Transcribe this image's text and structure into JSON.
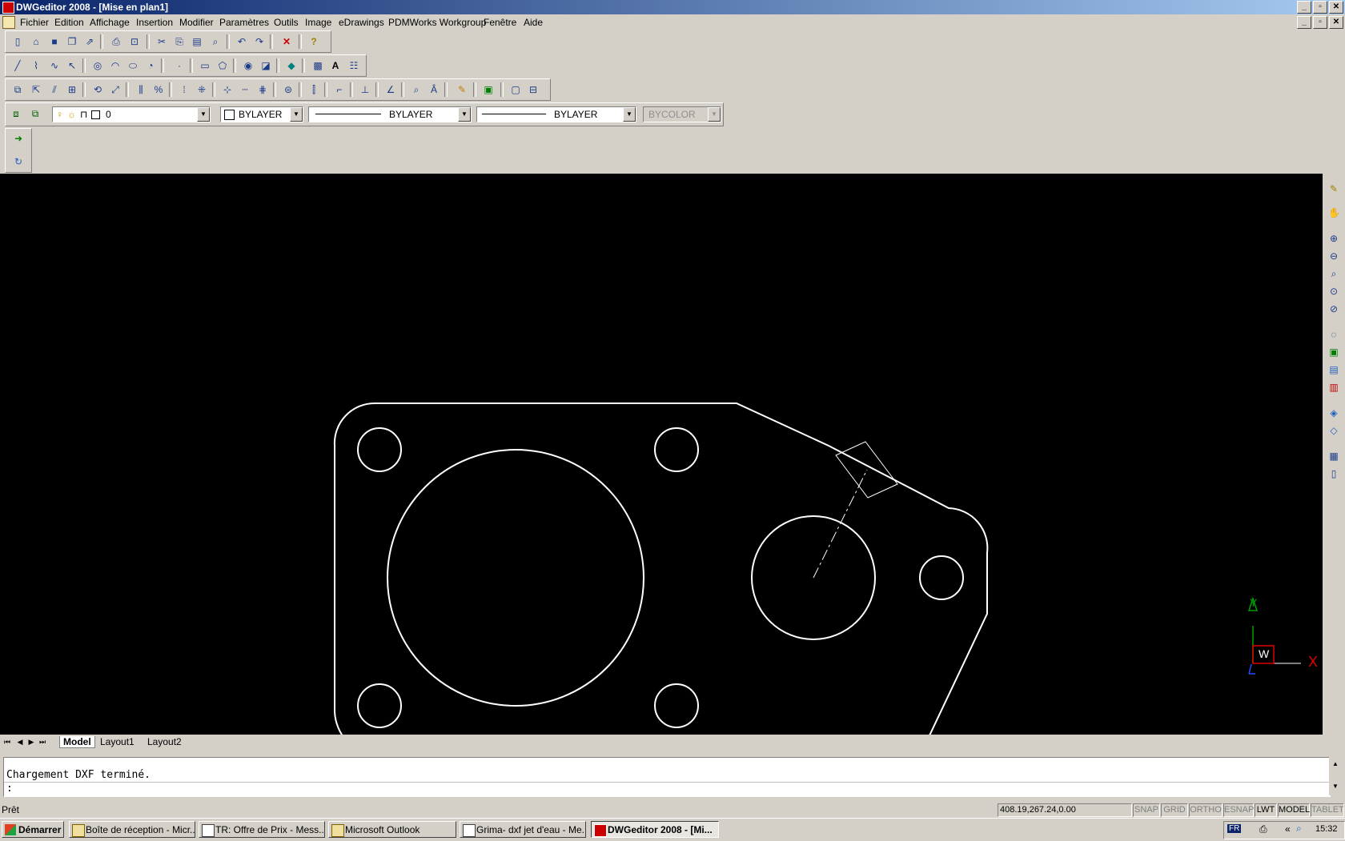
{
  "window": {
    "title": "DWGeditor 2008 - [Mise en plan1]"
  },
  "menu": [
    "Fichier",
    "Edition",
    "Affichage",
    "Insertion",
    "Modifier",
    "Paramètres",
    "Outils",
    "Image",
    "eDrawings",
    "PDMWorks Workgroup",
    "Fenêtre",
    "Aide"
  ],
  "properties": {
    "layer": "0",
    "color": "BYLAYER",
    "linetype": "BYLAYER",
    "lineweight": "BYLAYER",
    "plotstyle": "BYCOLOR"
  },
  "tabs": [
    "Model",
    "Layout1",
    "Layout2"
  ],
  "active_tab": "Model",
  "command_line": {
    "history": "Chargement DXF terminé.",
    "prompt": ":"
  },
  "status": {
    "text": "Prêt",
    "coords": "408.19,267.24,0.00",
    "toggles": [
      {
        "label": "SNAP",
        "on": false
      },
      {
        "label": "GRID",
        "on": false
      },
      {
        "label": "ORTHO",
        "on": false
      },
      {
        "label": "ESNAP",
        "on": false
      },
      {
        "label": "LWT",
        "on": true
      },
      {
        "label": "MODEL",
        "on": true
      },
      {
        "label": "TABLET",
        "on": false
      }
    ]
  },
  "ucs": {
    "y": "Y",
    "x": "X",
    "w": "W"
  },
  "taskbar": {
    "start": "Démarrer",
    "tasks": [
      {
        "label": "Boîte de réception - Micr...",
        "active": false
      },
      {
        "label": "TR: Offre de Prix - Mess...",
        "active": false
      },
      {
        "label": "Microsoft Outlook",
        "active": false
      },
      {
        "label": "Grima- dxf jet d'eau - Me...",
        "active": false
      },
      {
        "label": "DWGeditor 2008 - [Mi...",
        "active": true
      }
    ],
    "lang": "FR",
    "clock": "15:32"
  },
  "colors": {
    "titlebar": "#0a246a",
    "canvas": "#000000",
    "drawing": "#ffffff",
    "ucs_y": "#00a000",
    "ucs_x": "#e00000"
  }
}
